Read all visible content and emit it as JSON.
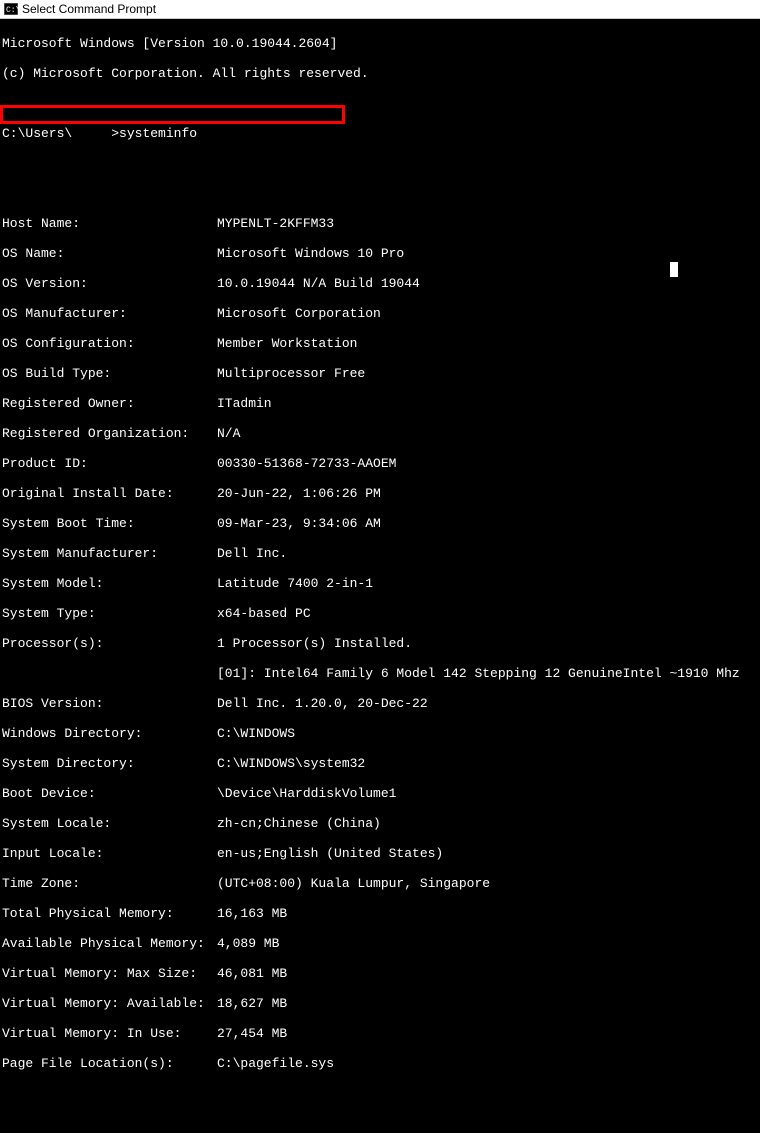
{
  "titlebar": {
    "title": "Select Command Prompt"
  },
  "header": {
    "line1": "Microsoft Windows [Version 10.0.19044.2604]",
    "line2": "(c) Microsoft Corporation. All rights reserved."
  },
  "prompt": {
    "path": "C:\\Users\\",
    "command": ">systeminfo"
  },
  "fields": [
    {
      "label": "Host Name:",
      "value": "MYPENLT-2KFFM33"
    },
    {
      "label": "OS Name:",
      "value": "Microsoft Windows 10 Pro"
    },
    {
      "label": "OS Version:",
      "value": "10.0.19044 N/A Build 19044"
    },
    {
      "label": "OS Manufacturer:",
      "value": "Microsoft Corporation"
    },
    {
      "label": "OS Configuration:",
      "value": "Member Workstation"
    },
    {
      "label": "OS Build Type:",
      "value": "Multiprocessor Free"
    },
    {
      "label": "Registered Owner:",
      "value": "ITadmin"
    },
    {
      "label": "Registered Organization:",
      "value": "N/A"
    },
    {
      "label": "Product ID:",
      "value": "00330-51368-72733-AAOEM"
    },
    {
      "label": "Original Install Date:",
      "value": "20-Jun-22, 1:06:26 PM"
    },
    {
      "label": "System Boot Time:",
      "value": "09-Mar-23, 9:34:06 AM"
    },
    {
      "label": "System Manufacturer:",
      "value": "Dell Inc."
    },
    {
      "label": "System Model:",
      "value": "Latitude 7400 2-in-1"
    },
    {
      "label": "System Type:",
      "value": "x64-based PC"
    },
    {
      "label": "Processor(s):",
      "value": "1 Processor(s) Installed."
    }
  ],
  "processor_detail": "[01]: Intel64 Family 6 Model 142 Stepping 12 GenuineIntel ~1910 Mhz",
  "fields2": [
    {
      "label": "BIOS Version:",
      "value": "Dell Inc. 1.20.0, 20-Dec-22"
    },
    {
      "label": "Windows Directory:",
      "value": "C:\\WINDOWS"
    },
    {
      "label": "System Directory:",
      "value": "C:\\WINDOWS\\system32"
    },
    {
      "label": "Boot Device:",
      "value": "\\Device\\HarddiskVolume1"
    },
    {
      "label": "System Locale:",
      "value": "zh-cn;Chinese (China)"
    },
    {
      "label": "Input Locale:",
      "value": "en-us;English (United States)"
    },
    {
      "label": "Time Zone:",
      "value": "(UTC+08:00) Kuala Lumpur, Singapore"
    },
    {
      "label": "Total Physical Memory:",
      "value": "16,163 MB"
    },
    {
      "label": "Available Physical Memory:",
      "value": "4,089 MB"
    },
    {
      "label": "Virtual Memory: Max Size:",
      "value": "46,081 MB"
    },
    {
      "label": "Virtual Memory: Available:",
      "value": "18,627 MB"
    },
    {
      "label": "Virtual Memory: In Use:",
      "value": "27,454 MB"
    },
    {
      "label": "Page File Location(s):",
      "value": "C:\\pagefile.sys"
    }
  ]
}
